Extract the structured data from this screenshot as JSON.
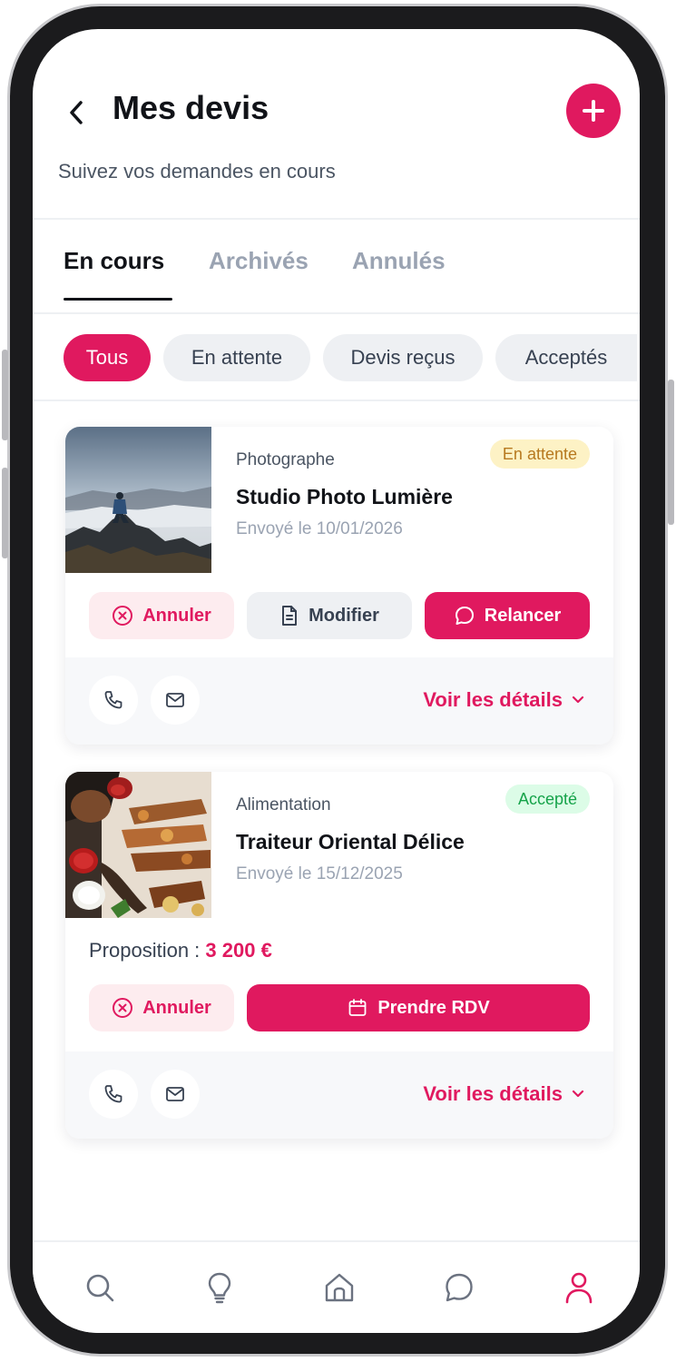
{
  "header": {
    "title": "Mes devis",
    "subtitle": "Suivez vos demandes en cours"
  },
  "tabs": [
    {
      "label": "En cours",
      "active": true
    },
    {
      "label": "Archivés",
      "active": false
    },
    {
      "label": "Annulés",
      "active": false
    }
  ],
  "filters": [
    {
      "label": "Tous",
      "active": true
    },
    {
      "label": "En attente",
      "active": false
    },
    {
      "label": "Devis reçus",
      "active": false
    },
    {
      "label": "Acceptés",
      "active": false
    }
  ],
  "quotes": [
    {
      "category": "Photographe",
      "vendor": "Studio Photo Lumière",
      "sent": "Envoyé le 10/01/2026",
      "status": "En attente",
      "image_icon": "landscape-photo",
      "actions": {
        "cancel": "Annuler",
        "edit": "Modifier",
        "remind": "Relancer"
      },
      "details_label": "Voir les détails"
    },
    {
      "category": "Alimentation",
      "vendor": "Traiteur Oriental Délice",
      "sent": "Envoyé le 15/12/2025",
      "status": "Accepté",
      "image_icon": "food-photo",
      "proposal_label": "Proposition :",
      "proposal_amount": "3 200 €",
      "actions": {
        "cancel": "Annuler",
        "book": "Prendre RDV"
      },
      "details_label": "Voir les détails"
    }
  ],
  "bottom_nav": [
    {
      "icon": "search-icon",
      "active": false
    },
    {
      "icon": "lightbulb-icon",
      "active": false
    },
    {
      "icon": "home-icon",
      "active": false
    },
    {
      "icon": "chat-icon",
      "active": false
    },
    {
      "icon": "user-icon",
      "active": true
    }
  ],
  "colors": {
    "accent": "#e0195f",
    "pending_bg": "#fdf2c5",
    "pending_text": "#b7791f",
    "accepted_bg": "#dcfce7",
    "accepted_text": "#16a34a"
  }
}
